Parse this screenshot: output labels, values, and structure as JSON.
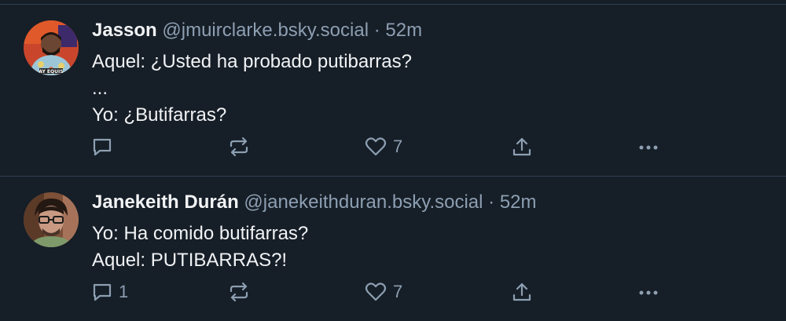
{
  "posts": [
    {
      "name": "Jasson",
      "handle": "@jmuirclarke.bsky.social",
      "separator": "·",
      "time": "52m",
      "lines": [
        "Aquel: ¿Usted ha probado putibarras?",
        "...",
        "Yo: ¿Butifarras?"
      ],
      "reply_count": "",
      "like_count": "7",
      "avatar_caption": "AY EQUIS"
    },
    {
      "name": "Janekeith Durán",
      "handle": "@janekeithduran.bsky.social",
      "separator": "·",
      "time": "52m",
      "lines": [
        "Yo: Ha comido butifarras?",
        "Aquel: PUTIBARRAS?!"
      ],
      "reply_count": "1",
      "like_count": "7"
    }
  ],
  "icons": [
    "reply-icon",
    "repost-icon",
    "like-icon",
    "share-icon",
    "more-icon"
  ],
  "colors": {
    "background": "#161e27",
    "muted": "#8d9fb2",
    "text": "#f1f3f5",
    "divider": "#2e4052"
  }
}
